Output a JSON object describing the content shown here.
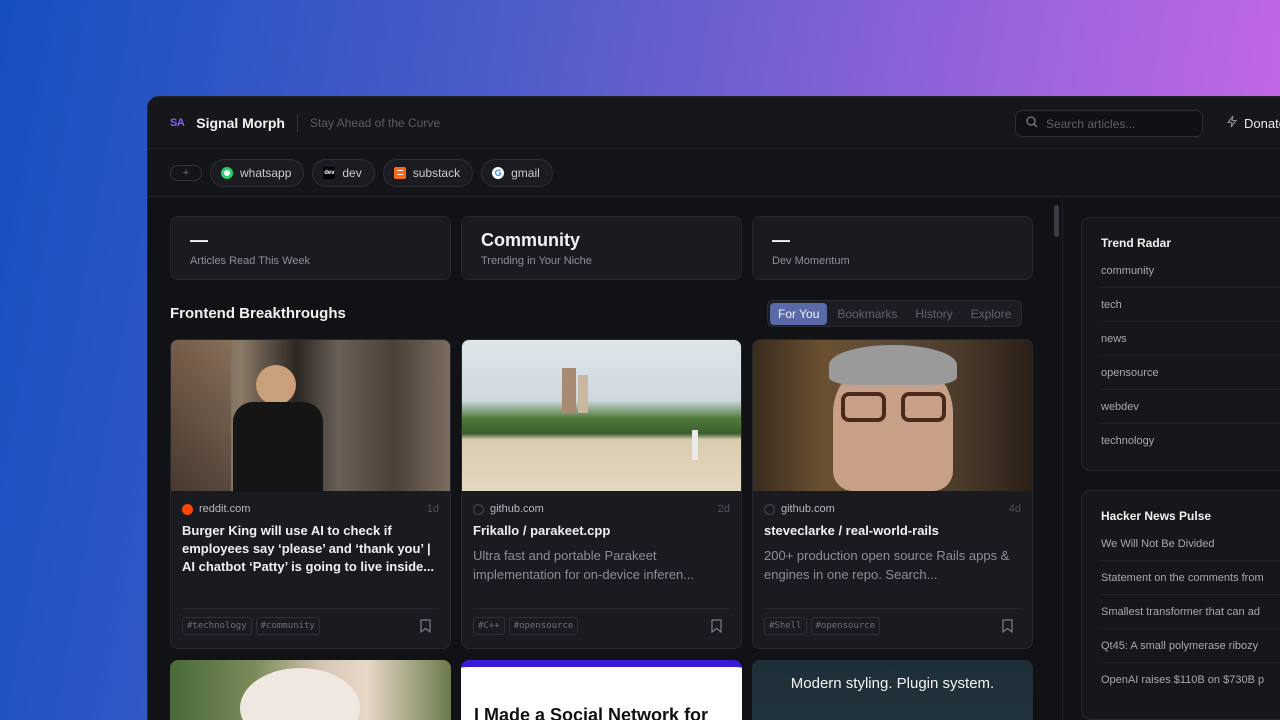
{
  "header": {
    "logo_text": "SA",
    "brand": "Signal Morph",
    "tagline": "Stay Ahead of the Curve",
    "search_placeholder": "Search articles...",
    "donate_label": "Donate"
  },
  "sources": {
    "add_label": "+",
    "chips": [
      {
        "label": "whatsapp",
        "icon": "whatsapp-icon",
        "color": "#25d366"
      },
      {
        "label": "dev",
        "icon": "dev-icon",
        "color": "#000000"
      },
      {
        "label": "substack",
        "icon": "substack-icon",
        "color": "#ff6719"
      },
      {
        "label": "gmail",
        "icon": "google-icon",
        "color": "#ea4335"
      }
    ]
  },
  "stats": [
    {
      "value": "—",
      "label": "Articles Read This Week"
    },
    {
      "value": "Community",
      "label": "Trending in Your Niche"
    },
    {
      "value": "—",
      "label": "Dev Momentum"
    }
  ],
  "section_title": "Frontend Breakthroughs",
  "tabs": [
    "For You",
    "Bookmarks",
    "History",
    "Explore"
  ],
  "active_tab": "For You",
  "cards": [
    {
      "source": "reddit.com",
      "source_icon": "reddit-icon",
      "ago": "1d",
      "title": "Burger King will use AI to check if employees say ‘please’ and ‘thank you’ | AI chatbot ‘Patty’ is going to live inside...",
      "desc": "",
      "tags": [
        "#technology",
        "#community"
      ]
    },
    {
      "source": "github.com",
      "source_icon": "github-icon",
      "ago": "2d",
      "title": "Frikallo / parakeet.cpp",
      "desc": "Ultra fast and portable Parakeet implementation for on-device inferen...",
      "tags": [
        "#C++",
        "#opensource"
      ]
    },
    {
      "source": "github.com",
      "source_icon": "github-icon",
      "ago": "4d",
      "title": "steveclarke / real-world-rails",
      "desc": "200+ production open source Rails apps & engines in one repo. Search...",
      "tags": [
        "#Shell",
        "#opensource"
      ]
    }
  ],
  "next_cards": [
    {
      "title": ""
    },
    {
      "title": "I Made a Social Network for"
    },
    {
      "title": "Modern styling. Plugin system."
    }
  ],
  "trend_radar": {
    "title": "Trend Radar",
    "items": [
      "community",
      "tech",
      "news",
      "opensource",
      "webdev",
      "technology"
    ]
  },
  "hn_pulse": {
    "title": "Hacker News Pulse",
    "items": [
      "We Will Not Be Divided",
      "Statement on the comments from",
      "Smallest transformer that can ad",
      "Qt45: A small polymerase ribozy",
      "OpenAI raises $110B on $730B p"
    ]
  },
  "colors": {
    "accent": "#5a6aa8",
    "brand": "#8f5bff"
  }
}
